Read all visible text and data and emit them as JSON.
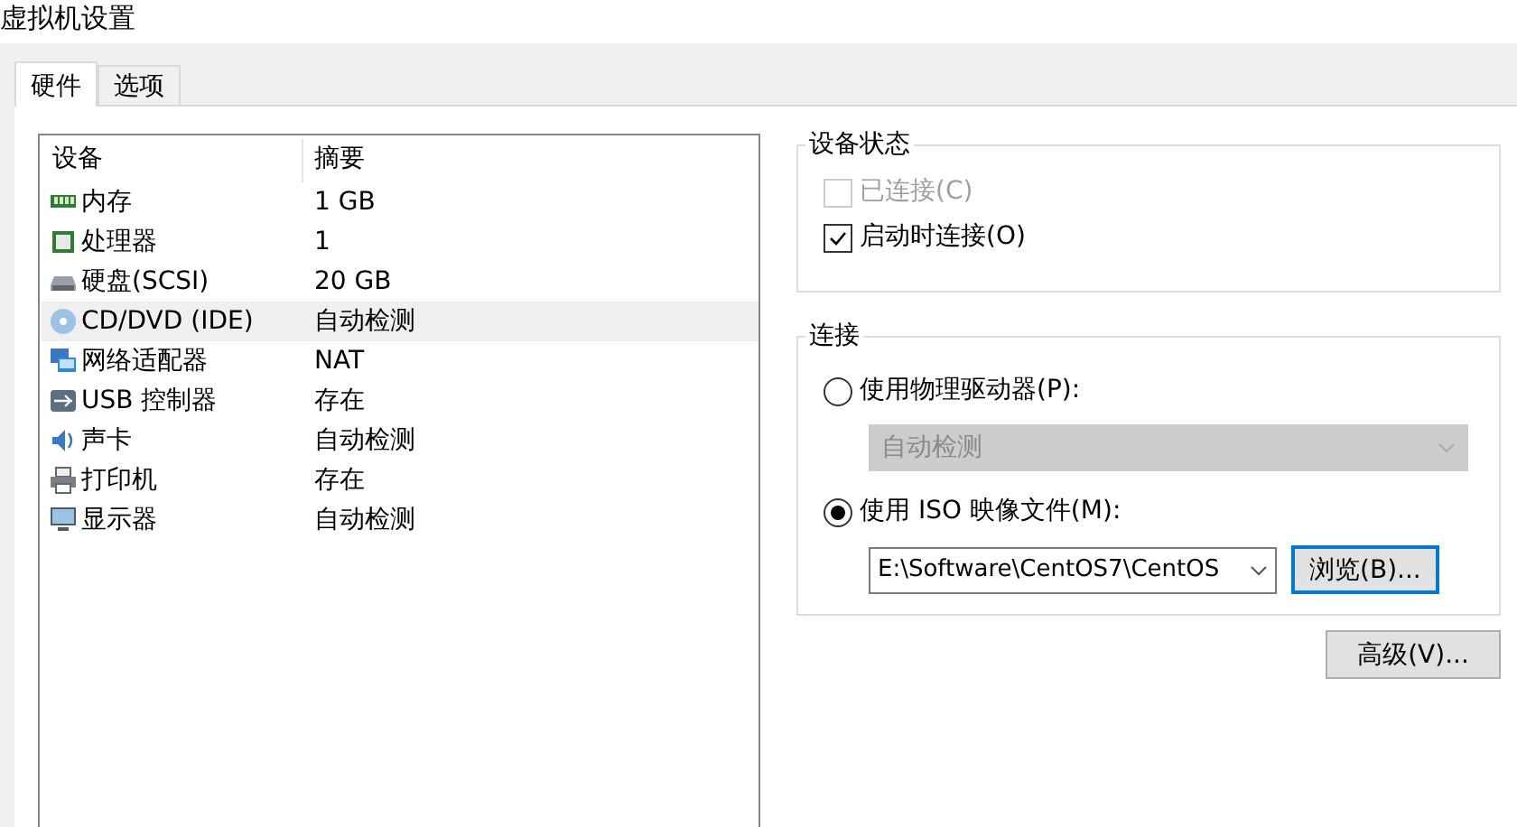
{
  "window": {
    "title": "虚拟机设置"
  },
  "tabs": [
    {
      "label": "硬件",
      "selected": true
    },
    {
      "label": "选项",
      "selected": false
    }
  ],
  "device_list": {
    "columns": [
      "设备",
      "摘要"
    ],
    "rows": [
      {
        "kind": "memory",
        "device": "内存",
        "summary": "1 GB",
        "selected": false
      },
      {
        "kind": "cpu",
        "device": "处理器",
        "summary": "1",
        "selected": false
      },
      {
        "kind": "disk",
        "device": "硬盘(SCSI)",
        "summary": "20 GB",
        "selected": false
      },
      {
        "kind": "cdrom",
        "device": "CD/DVD (IDE)",
        "summary": "自动检测",
        "selected": true
      },
      {
        "kind": "network",
        "device": "网络适配器",
        "summary": "NAT",
        "selected": false
      },
      {
        "kind": "usb",
        "device": "USB 控制器",
        "summary": "存在",
        "selected": false
      },
      {
        "kind": "sound",
        "device": "声卡",
        "summary": "自动检测",
        "selected": false
      },
      {
        "kind": "printer",
        "device": "打印机",
        "summary": "存在",
        "selected": false
      },
      {
        "kind": "display",
        "device": "显示器",
        "summary": "自动检测",
        "selected": false
      }
    ]
  },
  "device_status": {
    "title": "设备状态",
    "options": [
      {
        "label": "已连接(C)",
        "checked": false,
        "disabled": true
      },
      {
        "label": "启动时连接(O)",
        "checked": true,
        "disabled": false
      }
    ]
  },
  "connection": {
    "title": "连接",
    "physical": {
      "label": "使用物理驱动器(P):",
      "selected": false,
      "dropdown": {
        "value": "自动检测",
        "disabled": true
      }
    },
    "iso": {
      "label": "使用 ISO 映像文件(M):",
      "selected": true,
      "path": "E:\\Software\\CentOS7\\CentOS",
      "browse_button": "浏览(B)..."
    }
  },
  "advanced_button": "高级(V)..."
}
